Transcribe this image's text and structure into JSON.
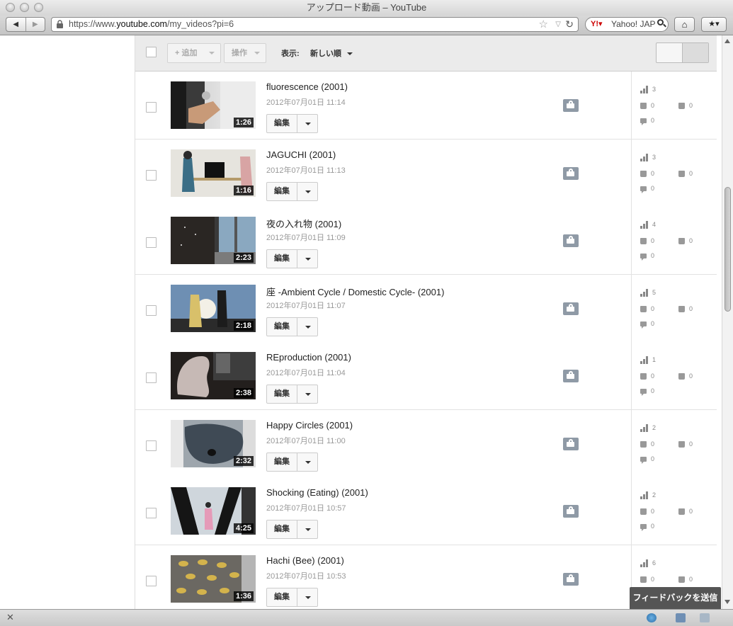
{
  "window": {
    "title": "アップロード動画 – YouTube"
  },
  "browser": {
    "url_prefix": "https://www.",
    "url_domain": "youtube.com",
    "url_path": "/my_videos?pi=6",
    "search_engine": "Yahoo! JAPAN",
    "search_label": "Yahoo! JAP"
  },
  "header": {
    "add_label": "+ 追加",
    "actions_label": "操作",
    "show_label": "表示:",
    "sort_label": "新しい順"
  },
  "videos": [
    {
      "title": "fluorescence (2001)",
      "date": "2012年07月01日 11:14",
      "duration": "1:26",
      "edit": "編集",
      "views": "3",
      "likes": "0",
      "dislikes": "0",
      "comments": "0"
    },
    {
      "title": "JAGUCHI (2001)",
      "date": "2012年07月01日 11:13",
      "duration": "1:16",
      "edit": "編集",
      "views": "3",
      "likes": "0",
      "dislikes": "0",
      "comments": "0"
    },
    {
      "title": "夜の入れ物 (2001)",
      "date": "2012年07月01日 11:09",
      "duration": "2:23",
      "edit": "編集",
      "views": "4",
      "likes": "0",
      "dislikes": "0",
      "comments": "0"
    },
    {
      "title": "座 -Ambient Cycle / Domestic Cycle- (2001)",
      "date": "2012年07月01日 11:07",
      "duration": "2:18",
      "edit": "編集",
      "views": "5",
      "likes": "0",
      "dislikes": "0",
      "comments": "0"
    },
    {
      "title": "REproduction (2001)",
      "date": "2012年07月01日 11:04",
      "duration": "2:38",
      "edit": "編集",
      "views": "1",
      "likes": "0",
      "dislikes": "0",
      "comments": "0"
    },
    {
      "title": "Happy Circles (2001)",
      "date": "2012年07月01日 11:00",
      "duration": "2:32",
      "edit": "編集",
      "views": "2",
      "likes": "0",
      "dislikes": "0",
      "comments": "0"
    },
    {
      "title": "Shocking (Eating) (2001)",
      "date": "2012年07月01日 10:57",
      "duration": "4:25",
      "edit": "編集",
      "views": "2",
      "likes": "0",
      "dislikes": "0",
      "comments": "0"
    },
    {
      "title": "Hachi (Bee) (2001)",
      "date": "2012年07月01日 10:53",
      "duration": "1:36",
      "edit": "編集",
      "views": "6",
      "likes": "0",
      "dislikes": "0",
      "comments": "0"
    }
  ],
  "feedback_label": "フィードバックを送信",
  "colors": {
    "privacy": "#8f9aa6",
    "feedback_bg": "#555555",
    "header_bg": "#ebebeb"
  }
}
